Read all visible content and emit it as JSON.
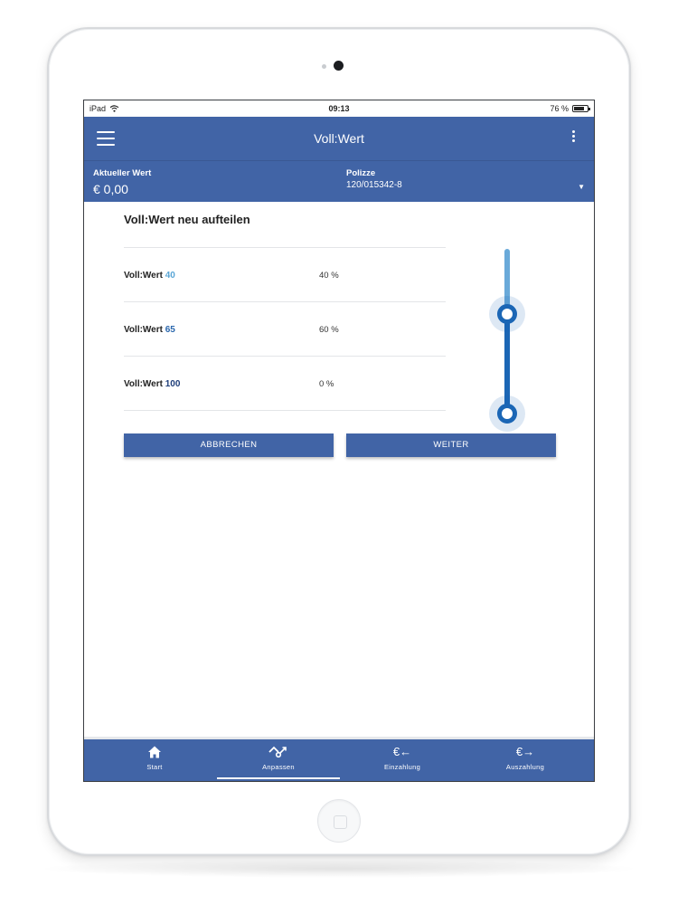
{
  "statusbar": {
    "device": "iPad",
    "time": "09:13",
    "battery": "76 %"
  },
  "appbar": {
    "title": "Voll:Wert"
  },
  "infobar": {
    "current_value_label": "Aktueller Wert",
    "current_value": "€ 0,00",
    "policy_label": "Polizze",
    "policy_number": "120/015342-8"
  },
  "main": {
    "title": "Voll:Wert neu aufteilen",
    "rows": [
      {
        "prefix": "Voll:Wert ",
        "number": "40",
        "percent": "40 %"
      },
      {
        "prefix": "Voll:Wert ",
        "number": "65",
        "percent": "60 %"
      },
      {
        "prefix": "Voll:Wert ",
        "number": "100",
        "percent": "0 %"
      }
    ],
    "cancel_label": "ABBRECHEN",
    "next_label": "WEITER"
  },
  "bottom_nav": {
    "items": [
      {
        "label": "Start",
        "icon": "home-icon"
      },
      {
        "label": "Anpassen",
        "icon": "adjust-icon"
      },
      {
        "label": "Einzahlung",
        "icon": "euro-in-icon"
      },
      {
        "label": "Auszahlung",
        "icon": "euro-out-icon"
      }
    ]
  },
  "colors": {
    "primary": "#4164a6",
    "slider_light": "#69a9d9",
    "slider_dark": "#1b66b5"
  }
}
